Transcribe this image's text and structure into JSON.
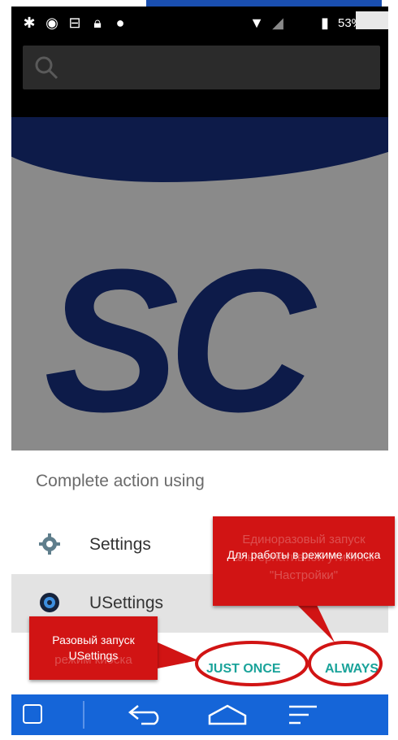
{
  "status_bar": {
    "icons": [
      "gear-icon",
      "eye-icon",
      "teamviewer-icon",
      "lock-icon",
      "leaf-icon",
      "wifi-icon",
      "no-signal-icon",
      "battery-icon"
    ],
    "battery_text": "53%"
  },
  "search": {
    "icon": "search-icon"
  },
  "hero": {
    "logo_text": "SC"
  },
  "chooser": {
    "title": "Complete action using",
    "options": [
      {
        "label": "Settings",
        "icon": "settings-gear-icon"
      },
      {
        "label": "USettings",
        "icon": "usettings-icon"
      }
    ],
    "just_once_label": "JUST ONCE",
    "always_label": "ALWAYS"
  },
  "callouts": {
    "right": {
      "ghost_text": "Единоразовый запуск альтернативной утилиты \"Настройки\"",
      "text": "Для работы в режиме киоска"
    },
    "left": {
      "text": "Разовый запуск USettings",
      "ghost_text": "режим киоска"
    }
  },
  "navbar": {
    "icons": [
      "teamviewer-icon",
      "back-icon",
      "home-icon",
      "recents-icon"
    ]
  },
  "colors": {
    "accent": "#1aa39a",
    "navbar": "#1565d8",
    "callout": "#d11414",
    "logo_navy": "#0d1b49"
  }
}
